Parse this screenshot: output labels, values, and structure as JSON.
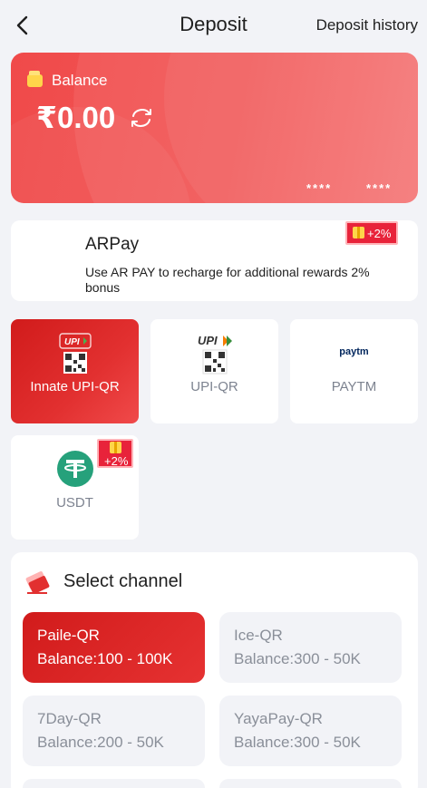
{
  "header": {
    "title": "Deposit",
    "history_label": "Deposit history"
  },
  "balance": {
    "label": "Balance",
    "amount": "₹0.00",
    "masked_left": "****",
    "masked_right": "****"
  },
  "arpay": {
    "name": "ARPay",
    "description": "Use AR PAY to recharge for additional rewards 2% bonus",
    "bonus": "+2%"
  },
  "payment_methods": [
    {
      "label": "Innate UPI-QR",
      "active": true
    },
    {
      "label": "UPI-QR",
      "active": false
    },
    {
      "label": "PAYTM",
      "active": false,
      "logo_text": "paytm"
    },
    {
      "label": "USDT",
      "active": false,
      "bonus": "+2%"
    }
  ],
  "channel": {
    "title": "Select channel",
    "items": [
      {
        "name": "Paile-QR",
        "balance": "Balance:100 - 100K",
        "active": true
      },
      {
        "name": "Ice-QR",
        "balance": "Balance:300 - 50K",
        "active": false
      },
      {
        "name": "7Day-QR",
        "balance": "Balance:200 - 50K",
        "active": false
      },
      {
        "name": "YayaPay-QR",
        "balance": "Balance:300 - 50K",
        "active": false
      }
    ]
  },
  "colors": {
    "accent": "#e23030",
    "background": "#f2f3f7",
    "usdt": "#26a17b"
  },
  "icons": {
    "back": "chevron-left-icon",
    "wallet": "wallet-icon",
    "refresh": "refresh-icon",
    "gift": "gift-icon",
    "channel": "card-icon"
  }
}
